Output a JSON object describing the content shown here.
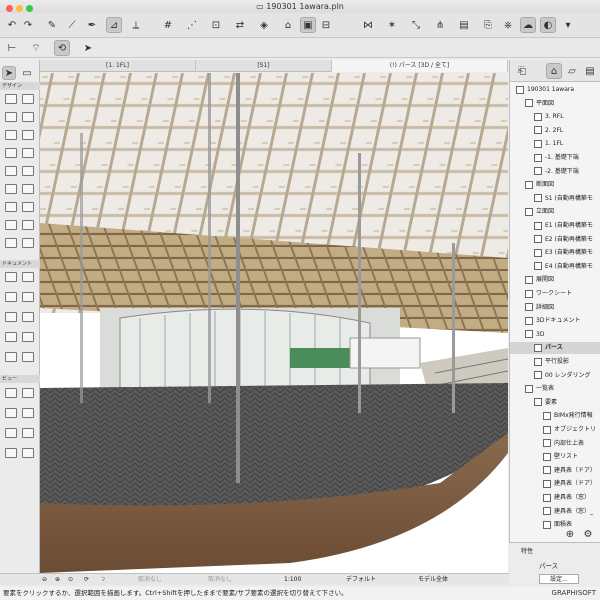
{
  "window": {
    "title": "190301 1awara.pln"
  },
  "tabs": [
    {
      "label": "[1. 1FL]"
    },
    {
      "label": "[S1]"
    },
    {
      "label": "(!) パース [3D / 全て]"
    }
  ],
  "toolbox": {
    "groups": [
      {
        "label": "デザイン"
      },
      {
        "label": "ドキュメント"
      },
      {
        "label": "ビュー"
      }
    ]
  },
  "navigator": {
    "items": [
      {
        "label": "190301 1awara",
        "icon": "project-icon",
        "indent": 0,
        "selected": false
      },
      {
        "label": "平面図",
        "icon": "folder-icon",
        "indent": 1,
        "selected": false
      },
      {
        "label": "3. RFL",
        "icon": "story-icon",
        "indent": 2,
        "selected": false
      },
      {
        "label": "2. 2FL",
        "icon": "story-icon",
        "indent": 2,
        "selected": false
      },
      {
        "label": "1. 1FL",
        "icon": "story-icon",
        "indent": 2,
        "selected": false
      },
      {
        "label": "-1. 基礎下端",
        "icon": "story-icon",
        "indent": 2,
        "selected": false
      },
      {
        "label": "-2. 基礎下端",
        "icon": "story-icon",
        "indent": 2,
        "selected": false
      },
      {
        "label": "断面図",
        "icon": "folder-icon",
        "indent": 1,
        "selected": false
      },
      {
        "label": "S1 (自動再構築モ",
        "icon": "section-icon",
        "indent": 2,
        "selected": false
      },
      {
        "label": "立面図",
        "icon": "folder-icon",
        "indent": 1,
        "selected": false
      },
      {
        "label": "E1 (自動再構築モ",
        "icon": "elevation-icon",
        "indent": 2,
        "selected": false
      },
      {
        "label": "E2 (自動再構築モ",
        "icon": "elevation-icon",
        "indent": 2,
        "selected": false
      },
      {
        "label": "E3 (自動再構築モ",
        "icon": "elevation-icon",
        "indent": 2,
        "selected": false
      },
      {
        "label": "E4 (自動再構築モ",
        "icon": "elevation-icon",
        "indent": 2,
        "selected": false
      },
      {
        "label": "展開図",
        "icon": "interior-icon",
        "indent": 1,
        "selected": false
      },
      {
        "label": "ワークシート",
        "icon": "worksheet-icon",
        "indent": 1,
        "selected": false
      },
      {
        "label": "詳細図",
        "icon": "detail-icon",
        "indent": 1,
        "selected": false
      },
      {
        "label": "3Dドキュメント",
        "icon": "document3d-icon",
        "indent": 1,
        "selected": false
      },
      {
        "label": "3D",
        "icon": "folder-icon",
        "indent": 1,
        "selected": false
      },
      {
        "label": "パース",
        "icon": "perspective-icon",
        "indent": 2,
        "selected": true
      },
      {
        "label": "平行投影",
        "icon": "axonometry-icon",
        "indent": 2,
        "selected": false
      },
      {
        "label": "00 レンダリング",
        "icon": "camera-icon",
        "indent": 2,
        "selected": false
      },
      {
        "label": "一覧表",
        "icon": "schedule-icon",
        "indent": 1,
        "selected": false
      },
      {
        "label": "要素",
        "icon": "folder-icon",
        "indent": 2,
        "selected": false
      },
      {
        "label": "BIMx発行情報",
        "icon": "table-icon",
        "indent": 3,
        "selected": false
      },
      {
        "label": "オブジェクトリ",
        "icon": "table-icon",
        "indent": 3,
        "selected": false
      },
      {
        "label": "内部仕上表",
        "icon": "table-icon",
        "indent": 3,
        "selected": false
      },
      {
        "label": "壁リスト",
        "icon": "table-icon",
        "indent": 3,
        "selected": false
      },
      {
        "label": "建具表（ドア）",
        "icon": "table-icon",
        "indent": 3,
        "selected": false
      },
      {
        "label": "建具表（ドア）",
        "icon": "table-icon",
        "indent": 3,
        "selected": false
      },
      {
        "label": "建具表（窓）",
        "icon": "table-icon",
        "indent": 3,
        "selected": false
      },
      {
        "label": "建具表（窓）_",
        "icon": "table-icon",
        "indent": 3,
        "selected": false
      },
      {
        "label": "面積表",
        "icon": "table-icon",
        "indent": 3,
        "selected": false
      }
    ]
  },
  "properties": {
    "header": "特性",
    "view_name": "パース",
    "settings_button": "設定..."
  },
  "statusbar": {
    "undo": "取消なし",
    "redo": "取消なし",
    "scale": "1:100",
    "layer_combo": "デフォルト",
    "model_view": "モデル全体"
  },
  "hint": "要素をクリックするか、選択範囲を描画します。Ctrl+Shiftを押したままで要素/サブ要素の選択を切り替えて下さい。",
  "brand": "GRAPHISOFT"
}
